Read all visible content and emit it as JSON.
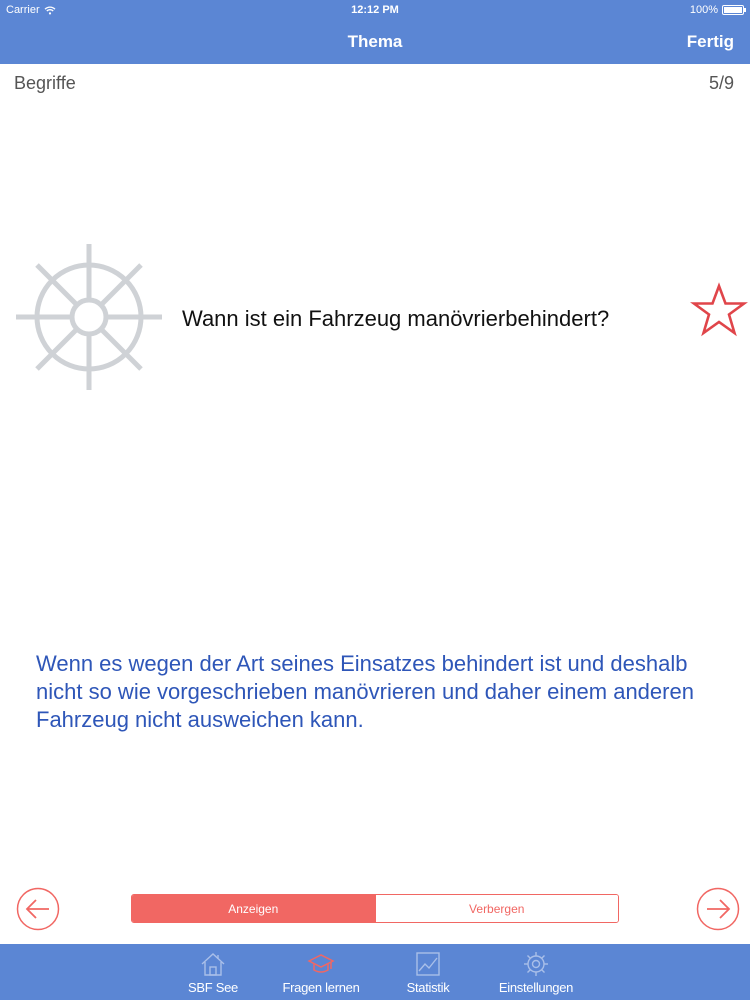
{
  "status_bar": {
    "carrier": "Carrier",
    "time": "12:12 PM",
    "battery": "100%"
  },
  "nav": {
    "title": "Thema",
    "done_label": "Fertig"
  },
  "card": {
    "category": "Begriffe",
    "counter": "5/9",
    "question": "Wann ist ein Fahrzeug manövrierbehindert?",
    "answer": "Wenn es wegen der Art seines Einsatzes behindert ist und deshalb nicht so wie vorgeschrieben manövrieren und daher einem anderen Fahrzeug nicht ausweichen kann.",
    "icon": "ships-wheel-icon",
    "favorite_icon": "star-outline-icon"
  },
  "controls": {
    "prev_icon": "arrow-left-circle-icon",
    "next_icon": "arrow-right-circle-icon",
    "segments": [
      {
        "label": "Anzeigen",
        "active": true
      },
      {
        "label": "Verbergen",
        "active": false
      }
    ]
  },
  "tabs": [
    {
      "label": "SBF See",
      "icon": "house-icon"
    },
    {
      "label": "Fragen lernen",
      "icon": "graduation-cap-icon",
      "selected": true
    },
    {
      "label": "Statistik",
      "icon": "chart-icon"
    },
    {
      "label": "Einstellungen",
      "icon": "gear-icon"
    }
  ],
  "colors": {
    "bar_blue": "#5b86d4",
    "accent_red": "#f16763",
    "answer_blue": "#2e56b8",
    "wheel_gray": "#cfd2d6"
  }
}
